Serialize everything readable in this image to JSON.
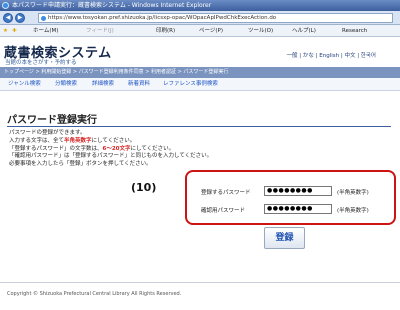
{
  "browser": {
    "window_title": "本パスワード申請実行：蔵書検索システム - Windows Internet Explorer",
    "url": "https://www.tosyokan.pref.shizuoka.jp/licsxp-opac/WOpacApIPwdChkExecAction.do",
    "favorites": {
      "home": "ホーム(M)",
      "feeds": "フィード(J)",
      "print": "印刷(R)",
      "page": "ページ(P)",
      "tools": "ツール(O)",
      "help": "ヘルプ(L)",
      "research": "Research"
    }
  },
  "header": {
    "logo": "蔵書検索システム",
    "tagline": "当館の本をさがす・予約する",
    "languages": "一般 | かな | English | 中文 | 한국어"
  },
  "breadcrumb": "トップページ > 利用開始登録 > パスワード登録利用条件同意 > 利用者認証 > パスワード登録実行",
  "menu": [
    "ジャンル検索",
    "分類検索",
    "詳細検索",
    "新着資料",
    "レファレンス事例検索"
  ],
  "main": {
    "title": "パスワード登録実行",
    "notes": {
      "line1": "パスワードの登録ができます。",
      "line2_pre": "入力する文字は、全て",
      "line2_red": "半角英数字",
      "line2_post": "にしてください。",
      "line3_pre": "「登録するパスワード」の文字数は、",
      "line3_red": "6～20文字",
      "line3_post": "にしてください。",
      "line4": "「確認用パスワード」は「登録するパスワード」と同じものを入力してください。",
      "line5": "必要事項を入力したら「登録」ボタンを押してください。"
    },
    "step_label": "(10)",
    "form": {
      "password_label": "登録するパスワード",
      "password_value": "●●●●●●●●",
      "password_note": "(半角英数字)",
      "confirm_label": "確認用パスワード",
      "confirm_value": "●●●●●●●●",
      "confirm_note": "(半角英数字)"
    },
    "submit_label": "登録"
  },
  "footer": "Copyright © Shizuoka Prefectural Central Library All Rights Reserved.",
  "colors": {
    "accent": "#1a53c4",
    "highlight_box": "#cc1414",
    "breadcrumb_bg": "#7a93bf"
  }
}
